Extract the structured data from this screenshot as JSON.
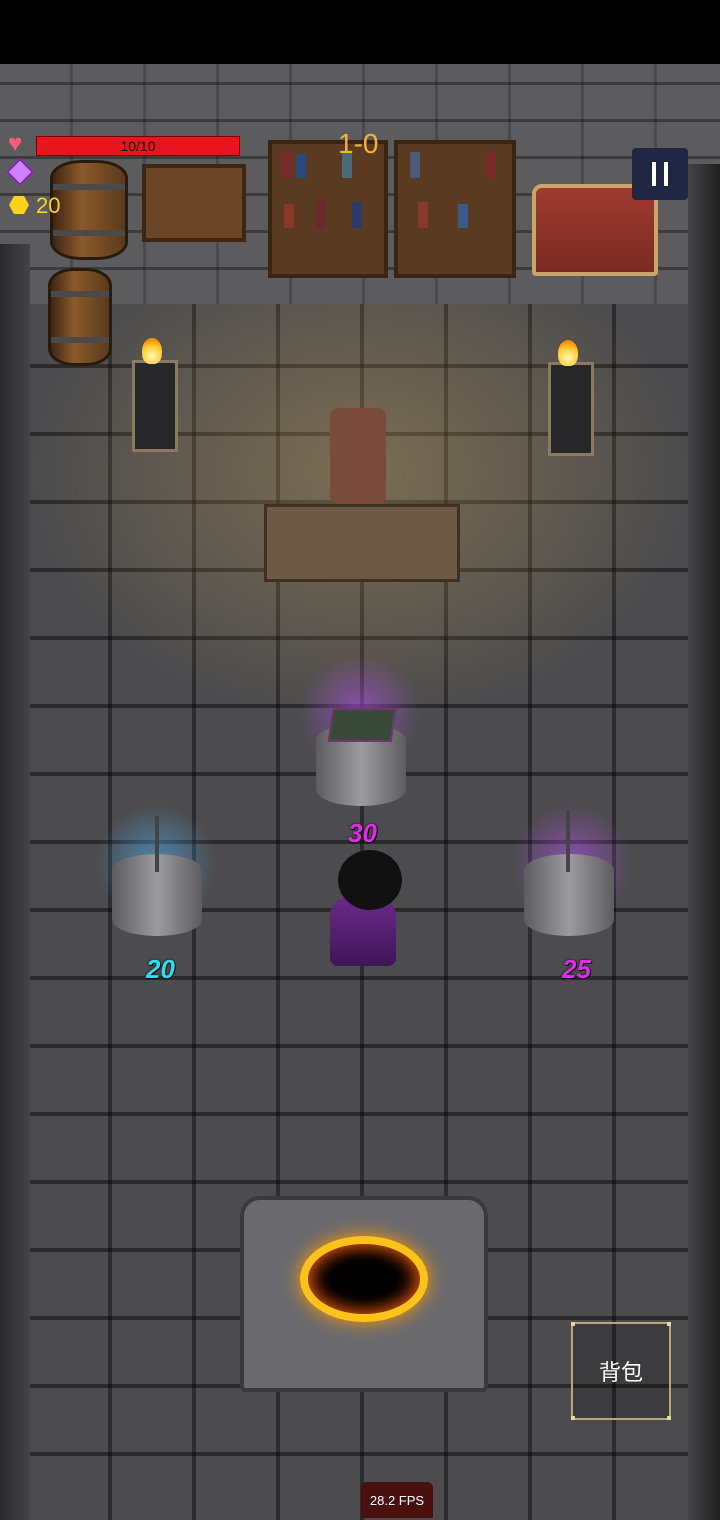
{
  "hud": {
    "hp_text": "10/10",
    "hp_fraction": 1.0,
    "gem_count": "",
    "coin_count": "20",
    "level": "1-0",
    "pause_icon": "pause-icon",
    "heart_icon": "heart-icon",
    "gem_icon": "gem-icon",
    "coin_icon": "coin-icon"
  },
  "shop": {
    "price_center": "30",
    "price_left": "20",
    "price_right": "25"
  },
  "buttons": {
    "bag_label": "背包"
  },
  "status": {
    "fps": "28.2 FPS"
  },
  "colors": {
    "hp": "#e8141e",
    "coin": "#ffd21a",
    "level": "#f2b234",
    "price_purple": "#e22ae8",
    "price_cyan": "#27e0f0"
  }
}
